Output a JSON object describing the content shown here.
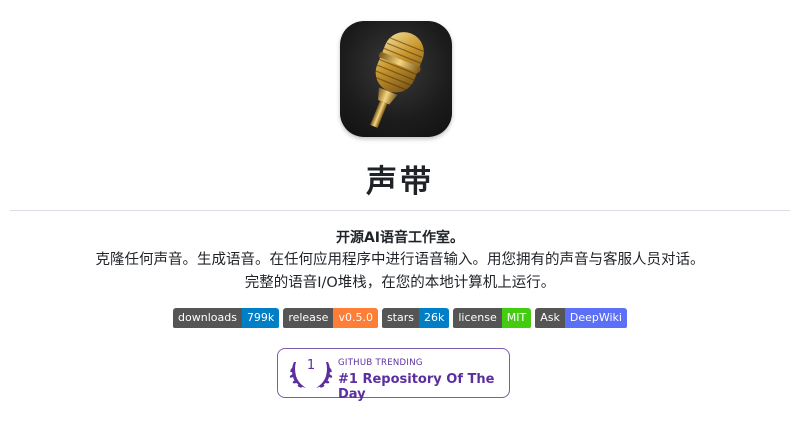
{
  "header": {
    "app_icon": "golden-microphone-icon",
    "title": "声带"
  },
  "intro": {
    "tagline": "开源AI语音工作室。",
    "line1": "克隆任何声音。生成语音。在任何应用程序中进行语音输入。用您拥有的声音与客服人员对话。",
    "line2": "完整的语音I/O堆栈，在您的本地计算机上运行。"
  },
  "badges": [
    {
      "key": "downloads",
      "value": "799k",
      "color": "#007ec6"
    },
    {
      "key": "release",
      "value": "v0.5.0",
      "color": "#fe7d37"
    },
    {
      "key": "stars",
      "value": "26k",
      "color": "#007ec6"
    },
    {
      "key": "license",
      "value": "MIT",
      "color": "#4c1"
    },
    {
      "key": "Ask",
      "value": "DeepWiki",
      "color": "#5b6ff7"
    }
  ],
  "trending": {
    "rank": "1",
    "label": "GITHUB TRENDING",
    "headline": "#1 Repository Of The Day"
  },
  "colors": {
    "accent_purple": "#5b2fa0",
    "link_blue": "#0969da"
  }
}
